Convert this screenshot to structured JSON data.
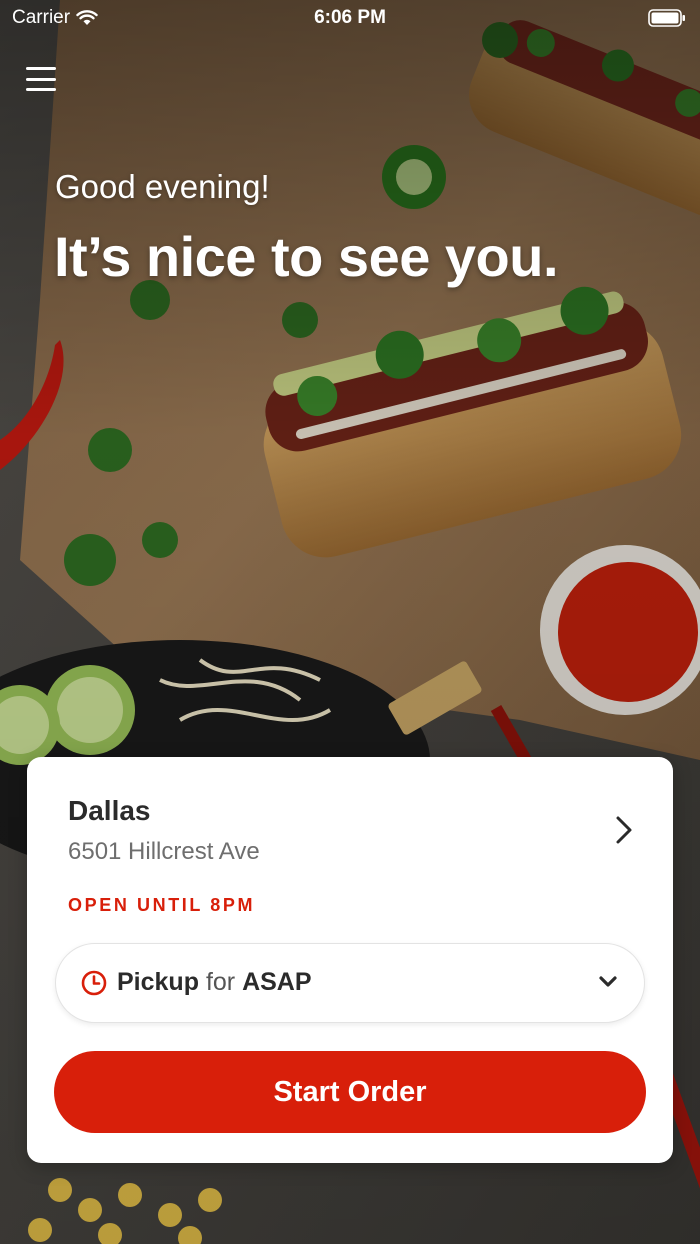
{
  "status_bar": {
    "carrier": "Carrier",
    "time": "6:06 PM"
  },
  "greeting": {
    "salutation": "Good evening!",
    "headline": "It’s nice to see you."
  },
  "location": {
    "city": "Dallas",
    "address": "6501 Hillcrest Ave",
    "status": "OPEN UNTIL 8PM"
  },
  "order_options": {
    "method": "Pickup",
    "connector": "for",
    "time": "ASAP"
  },
  "actions": {
    "start_order": "Start Order"
  },
  "theme": {
    "accent": "#d81f0a"
  },
  "icons": [
    "menu-icon",
    "wifi-icon",
    "battery-icon",
    "chevron-right-icon",
    "clock-icon",
    "chevron-down-icon"
  ]
}
